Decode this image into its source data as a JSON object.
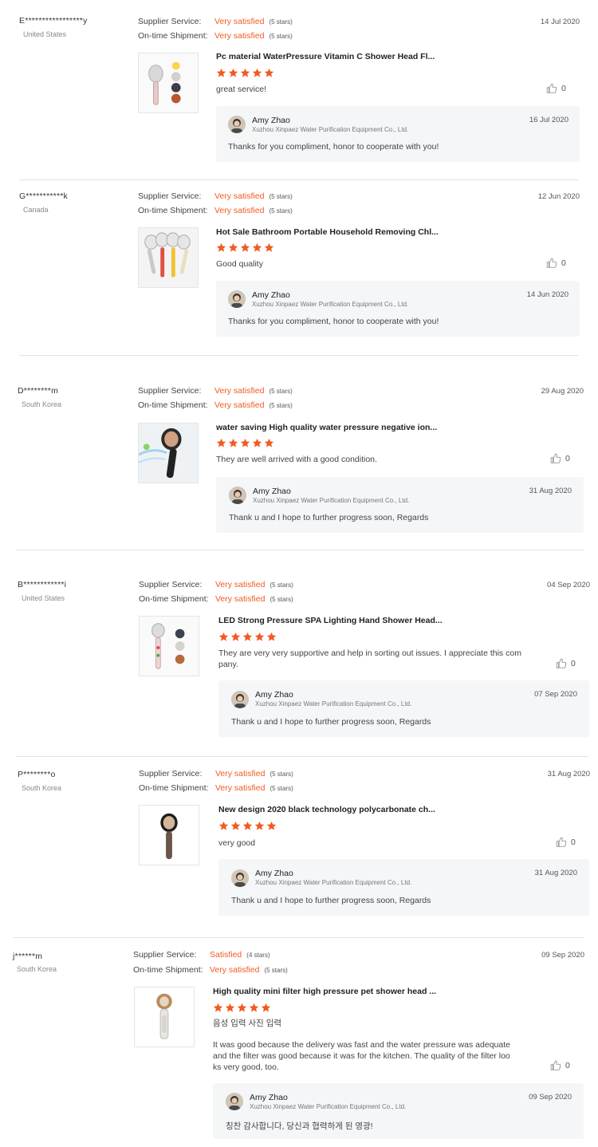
{
  "labels": {
    "supplier_service": "Supplier Service:",
    "on_time_shipment": "On-time Shipment:"
  },
  "colors": {
    "accent": "#f15a22"
  },
  "reviews": [
    {
      "buyer": "E*****************y",
      "country": "United States",
      "supplier_rating": "Very satisfied",
      "supplier_stars": "(5 stars)",
      "shipment_rating": "Very satisfied",
      "shipment_stars": "(5 stars)",
      "date": "14 Jul 2020",
      "product_title": "Pc material WaterPressure Vitamin C Shower Head Fl...",
      "star_count": 5,
      "comment": "great service!",
      "likes": "0",
      "reply": {
        "name": "Amy Zhao",
        "company": "Xuzhou Xinpaez Water Purification Equipment Co., Ltd.",
        "date": "16 Jul 2020",
        "text": "Thanks for you compliment, honor to cooperate with you!"
      }
    },
    {
      "buyer": "G***********k",
      "country": "Canada",
      "supplier_rating": "Very satisfied",
      "supplier_stars": "(5 stars)",
      "shipment_rating": "Very satisfied",
      "shipment_stars": "(5 stars)",
      "date": "12 Jun 2020",
      "product_title": "Hot Sale Bathroom Portable Household Removing Chl...",
      "star_count": 5,
      "comment": "Good quality",
      "likes": "0",
      "reply": {
        "name": "Amy Zhao",
        "company": "Xuzhou Xinpaez Water Purification Equipment Co., Ltd.",
        "date": "14 Jun 2020",
        "text": "Thanks for you compliment, honor to cooperate with you!"
      }
    },
    {
      "buyer": "D********m",
      "country": "South Korea",
      "supplier_rating": "Very satisfied",
      "supplier_stars": "(5 stars)",
      "shipment_rating": "Very satisfied",
      "shipment_stars": "(5 stars)",
      "date": "29 Aug 2020",
      "product_title": "water saving High quality water pressure negative ion...",
      "star_count": 5,
      "comment": "They are well arrived with a good condition.",
      "likes": "0",
      "reply": {
        "name": "Amy Zhao",
        "company": "Xuzhou Xinpaez Water Purification Equipment Co., Ltd.",
        "date": "31 Aug 2020",
        "text": "Thank u and I hope to further progress soon, Regards"
      }
    },
    {
      "buyer": "B************i",
      "country": "United States",
      "supplier_rating": "Very satisfied",
      "supplier_stars": "(5 stars)",
      "shipment_rating": "Very satisfied",
      "shipment_stars": "(5 stars)",
      "date": "04 Sep 2020",
      "product_title": "LED Strong Pressure SPA Lighting Hand Shower Head...",
      "star_count": 5,
      "comment": "They are very very supportive and help in sorting out issues. I appreciate this com pany.",
      "likes": "0",
      "reply": {
        "name": "Amy Zhao",
        "company": "Xuzhou Xinpaez Water Purification Equipment Co., Ltd.",
        "date": "07 Sep 2020",
        "text": "Thank u and I hope to further progress soon, Regards"
      }
    },
    {
      "buyer": "P********o",
      "country": "South Korea",
      "supplier_rating": "Very satisfied",
      "supplier_stars": "(5 stars)",
      "shipment_rating": "Very satisfied",
      "shipment_stars": "(5 stars)",
      "date": "31 Aug 2020",
      "product_title": "New design 2020 black technology polycarbonate ch...",
      "star_count": 5,
      "comment": "very good",
      "likes": "0",
      "reply": {
        "name": "Amy Zhao",
        "company": "Xuzhou Xinpaez Water Purification Equipment Co., Ltd.",
        "date": "31 Aug 2020",
        "text": "Thank u and I hope to further progress soon, Regards"
      }
    },
    {
      "buyer": "j******m",
      "country": "South Korea",
      "supplier_rating": "Satisfied",
      "supplier_stars": "(4 stars)",
      "shipment_rating": "Very satisfied",
      "shipment_stars": "(5 stars)",
      "date": "09 Sep 2020",
      "product_title": "High quality mini filter high pressure pet shower head ...",
      "star_count": 5,
      "comment_line1": "음성 입력 사진 입력",
      "comment": "It was good because the delivery was fast and the water pressure was adequate and the filter was good because it was for the kitchen. The quality of the filter loo ks very good, too.",
      "likes": "0",
      "reply": {
        "name": "Amy Zhao",
        "company": "Xuzhou Xinpaez Water Purification Equipment Co., Ltd.",
        "date": "09 Sep 2020",
        "text": "칭찬 감사합니다, 당신과 협력하게 된 영광!"
      }
    }
  ]
}
